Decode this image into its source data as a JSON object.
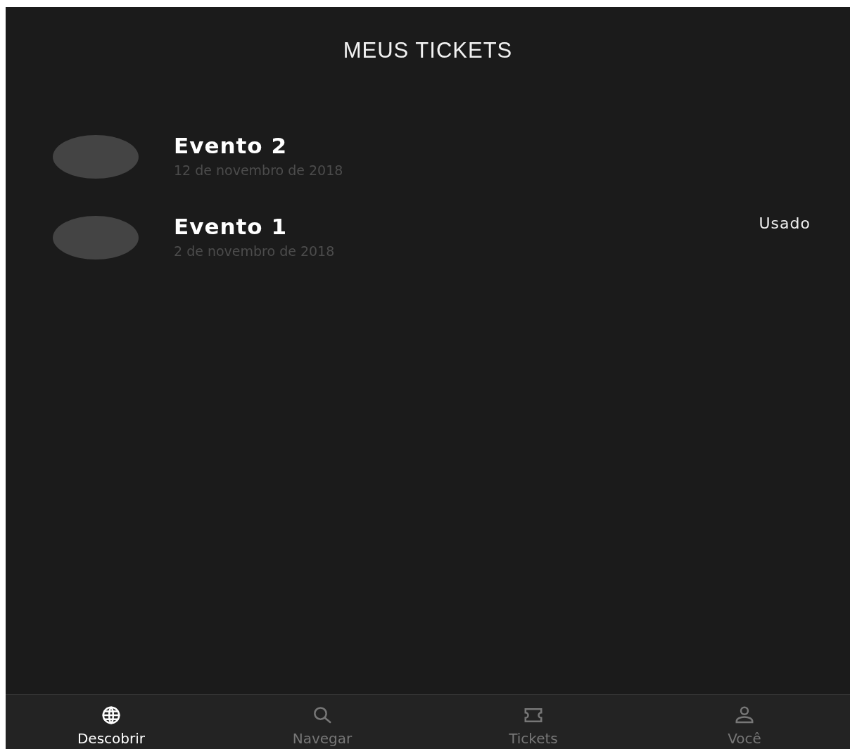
{
  "header": {
    "title": "MEUS TICKETS"
  },
  "tickets": [
    {
      "name": "Evento 2",
      "date": "12 de novembro de 2018"
    },
    {
      "name": "Evento 1",
      "date": "2 de novembro de 2018",
      "status": "Usado"
    }
  ],
  "tab_bar": [
    {
      "kind": "globe",
      "label": "Descobrir",
      "selected": true
    },
    {
      "kind": "search",
      "label": "Navegar",
      "selected": false
    },
    {
      "kind": "ticket",
      "label": "Tickets",
      "selected": false
    },
    {
      "kind": "person",
      "label": "Você",
      "selected": false
    }
  ]
}
